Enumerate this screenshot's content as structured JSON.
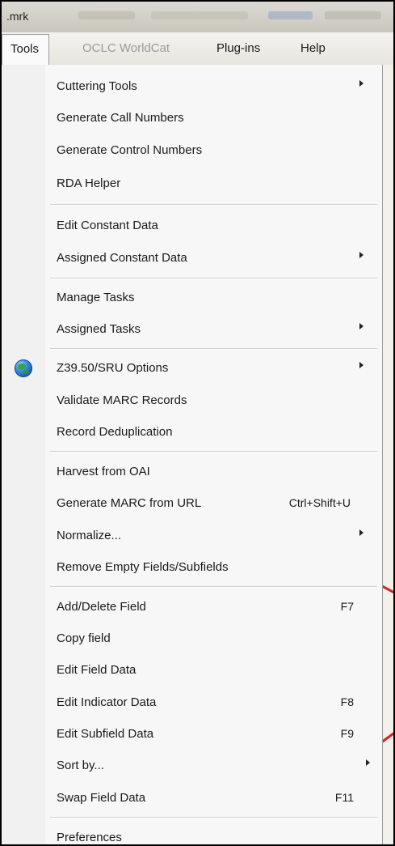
{
  "window": {
    "title": ".mrk"
  },
  "menubar": {
    "items": [
      {
        "label": "Tools"
      },
      {
        "label": "OCLC WorldCat"
      },
      {
        "label": "Plug-ins"
      },
      {
        "label": "Help"
      }
    ]
  },
  "tools_menu": {
    "items": [
      {
        "label": "Cuttering Tools",
        "submenu": true
      },
      {
        "label": "Generate Call Numbers"
      },
      {
        "label": "Generate Control Numbers"
      },
      {
        "label": "RDA Helper"
      },
      {
        "label": "Edit Constant Data"
      },
      {
        "label": "Assigned Constant Data",
        "submenu": true
      },
      {
        "label": "Manage Tasks"
      },
      {
        "label": "Assigned Tasks",
        "submenu": true
      },
      {
        "label": "Z39.50/SRU Options",
        "submenu": true,
        "icon": "globe-icon"
      },
      {
        "label": "Validate MARC Records"
      },
      {
        "label": "Record Deduplication"
      },
      {
        "label": "Harvest from OAI"
      },
      {
        "label": "Generate MARC from URL",
        "shortcut": "Ctrl+Shift+U"
      },
      {
        "label": "Normalize...",
        "submenu": true
      },
      {
        "label": "Remove Empty Fields/Subfields"
      },
      {
        "label": "Add/Delete Field",
        "shortcut": "F7"
      },
      {
        "label": "Copy field"
      },
      {
        "label": "Edit Field Data"
      },
      {
        "label": "Edit Indicator Data",
        "shortcut": "F8"
      },
      {
        "label": "Edit Subfield Data",
        "shortcut": "F9"
      },
      {
        "label": "Sort by...",
        "submenu": true
      },
      {
        "label": "Swap Field Data",
        "shortcut": "F11"
      },
      {
        "label": "Preferences"
      }
    ]
  },
  "colors": {
    "menu_background": "#f7f7f7",
    "annotation_red": "#d81e1e"
  }
}
